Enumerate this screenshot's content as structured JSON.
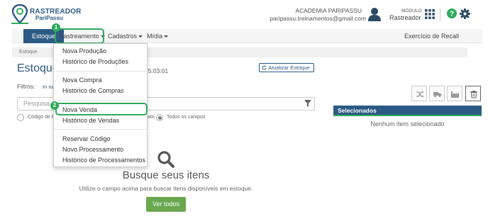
{
  "header": {
    "logo_title": "RASTREADOR",
    "logo_subtitle": "PariPassu",
    "account_name": "ACADEMIA PARIPASSU",
    "account_email": "paripassu.treinamentos@gmail.com",
    "modulo_label": "MÓDULO",
    "modulo_value": "Rastreador",
    "brand_color": "#2c5a85",
    "accent_color": "#2eaa5c"
  },
  "nav": {
    "items": [
      {
        "label": "Estoque"
      },
      {
        "label": "Rastreamento"
      },
      {
        "label": "Cadastros"
      },
      {
        "label": "Mídia"
      }
    ],
    "right_item": "Exercício de Recall"
  },
  "breadcrumb": "Estoque",
  "page": {
    "title": "Estoque",
    "time_fragment": "15:03:01",
    "refresh_button": "Atualizar Estoque",
    "filters_label": "Filtros:",
    "filters_value": "In na"
  },
  "search": {
    "placeholder": "Pesquisa",
    "radio_options": [
      {
        "label": "Código de R",
        "checked": false
      },
      {
        "label": "ato",
        "checked": false
      },
      {
        "label": "Todos os campos",
        "checked": true
      }
    ]
  },
  "toolbar_icons": [
    "shuffle-icon",
    "truck-icon",
    "factory-icon",
    "trash-icon"
  ],
  "selected_panel": {
    "title": "Selecionados",
    "empty_text": "Nenhum item selecionado"
  },
  "empty_state": {
    "title": "Busque seus itens",
    "description": "Utilize o campo acima para buscar itens disponíveis em estoque.",
    "button": "Ver todos"
  },
  "dropdown": {
    "groups": [
      [
        "Nova Produção",
        "Histórico de Produções"
      ],
      [
        "Nova Compra",
        "Histórico de Compras"
      ],
      [
        "Nova Venda",
        "Histórico de Vendas"
      ],
      [
        "Reservar Código",
        "Novo Processamento",
        "Histórico de Processamentos"
      ]
    ]
  },
  "callouts": [
    "1",
    "2"
  ]
}
